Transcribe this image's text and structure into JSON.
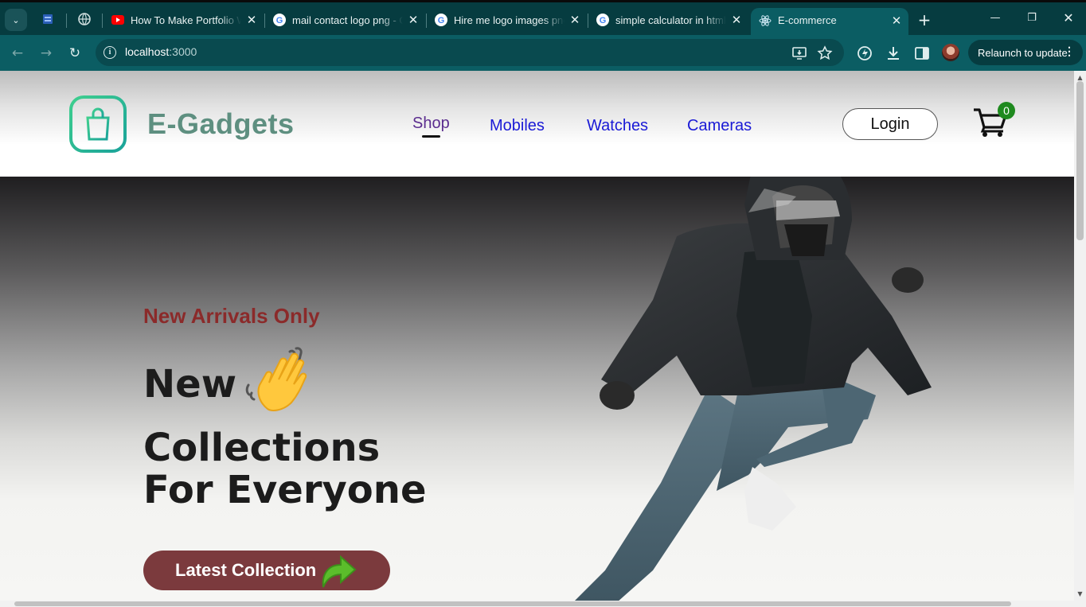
{
  "browser": {
    "tabs": [
      {
        "title": "How To Make Portfolio W",
        "favicon": "youtube-icon"
      },
      {
        "title": "mail contact logo png - G",
        "favicon": "google-icon"
      },
      {
        "title": "Hire me logo images png",
        "favicon": "google-icon"
      },
      {
        "title": "simple calculator in html",
        "favicon": "google-icon"
      },
      {
        "title": "E-commerce",
        "favicon": "react-icon",
        "active": true
      }
    ],
    "url_host": "localhost",
    "url_port": ":3000",
    "relaunch_label": "Relaunch to update"
  },
  "site": {
    "brand": "E-Gadgets",
    "nav": [
      "Shop",
      "Mobiles",
      "Watches",
      "Cameras"
    ],
    "active_nav": "Shop",
    "login_label": "Login",
    "cart_count": "0"
  },
  "hero": {
    "subtitle": "New Arrivals Only",
    "line1": "New",
    "line2": "Collections",
    "line3": "For Everyone",
    "cta_label": "Latest Collection"
  },
  "colors": {
    "chrome": "#0b5d63",
    "brand": "#5e8f80",
    "nav_link": "#1a1ad6",
    "subtitle": "#8b2a2a",
    "cta": "#7b3a3d",
    "badge": "#1f8a1f"
  }
}
